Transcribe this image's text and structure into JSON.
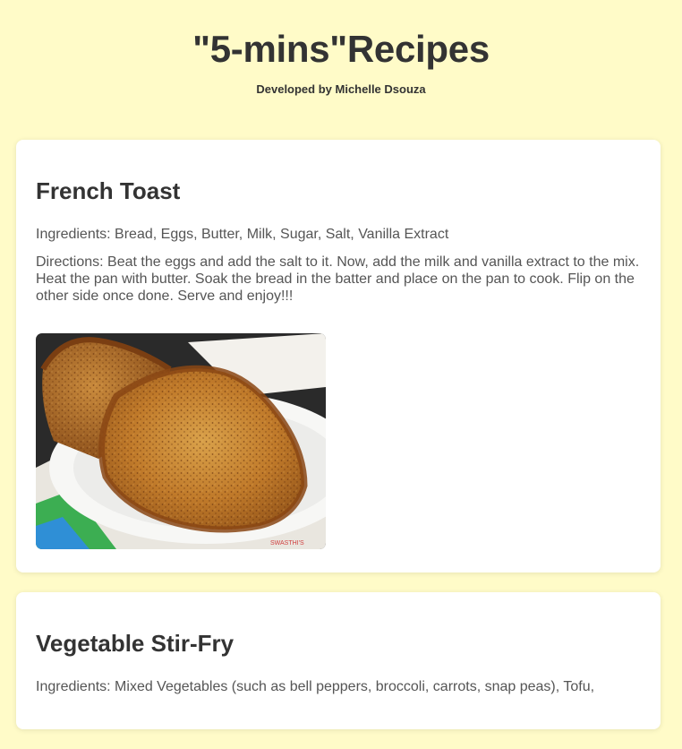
{
  "header": {
    "title": "\"5-mins\"Recipes",
    "byline": "Developed by Michelle Dsouza"
  },
  "recipes": [
    {
      "name": "French Toast",
      "ingredients": "Ingredients: Bread, Eggs, Butter, Milk, Sugar, Salt, Vanilla Extract",
      "directions": "Directions: Beat the eggs and add the salt to it. Now, add the milk and vanilla extract to the mix. Heat the pan with butter. Soak the bread in the batter and place on the pan to cook. Flip on the other side once done. Serve and enjoy!!!",
      "image_watermark": "SWASTHI'S"
    },
    {
      "name": "Vegetable Stir-Fry",
      "ingredients": "Ingredients: Mixed Vegetables (such as bell peppers, broccoli, carrots, snap peas), Tofu,"
    }
  ],
  "colors": {
    "page_background": "#fffbc8",
    "card_background": "#ffffff",
    "heading_text": "#333333",
    "body_text": "#555555"
  }
}
